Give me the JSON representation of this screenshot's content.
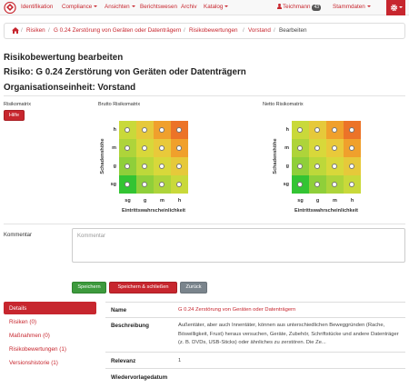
{
  "navbar": {
    "items": [
      {
        "label": "Identifikation"
      },
      {
        "label": "Compliance"
      },
      {
        "label": "Ansichten"
      },
      {
        "label": "Berichtswesen"
      },
      {
        "label": "Archiv"
      },
      {
        "label": "Katalog"
      }
    ],
    "user": "Teichmann",
    "user_badge": "43",
    "stammdaten": "Stammdaten",
    "accent": "#c7262e"
  },
  "breadcrumb": [
    "Risiken",
    "G 0.24 Zerstörung von Geräten oder Datenträgern",
    "Risikobewertungen",
    "Vorstand",
    "Bearbeiten"
  ],
  "headings": {
    "title": "Risikobewertung bearbeiten",
    "risk": "Risiko: G 0.24 Zerstörung von Geräten oder Datenträgern",
    "org": "Organisationseinheit: Vorstand"
  },
  "matrix_section": {
    "label": "Risikomatrix",
    "help_button": "Hilfe",
    "brutto_title": "Brutto Risikomatrix",
    "netto_title": "Netto Risikomatrix",
    "y_axis": "Schadenshöhe",
    "x_axis": "Eintrittswahrscheinlichkeit",
    "rows": [
      "h",
      "m",
      "g",
      "sg"
    ],
    "cols": [
      "sg",
      "g",
      "m",
      "h"
    ],
    "colors": [
      [
        "#c9d93a",
        "#e6c93a",
        "#f0a02c",
        "#ec7328"
      ],
      [
        "#aed43a",
        "#d8d83a",
        "#e9c93a",
        "#f0a02c"
      ],
      [
        "#8fcf3a",
        "#bdd83a",
        "#d8d83a",
        "#e6c93a"
      ],
      [
        "#33c433",
        "#8fcf3a",
        "#aed43a",
        "#c9d93a"
      ]
    ]
  },
  "comment": {
    "label": "Kommentar",
    "placeholder": "Kommentar"
  },
  "buttons": {
    "save": "Speichern",
    "save_close": "Speichern & schließen",
    "back": "Zurück"
  },
  "sidebar": [
    {
      "label": "Details"
    },
    {
      "label": "Risiken (0)"
    },
    {
      "label": "Maßnahmen (0)"
    },
    {
      "label": "Risikobewertungen (1)"
    },
    {
      "label": "Versionshistorie (1)"
    }
  ],
  "details": {
    "name_key": "Name",
    "name_val": "G 0.24 Zerstörung von Geräten oder Datenträgern",
    "desc_key": "Beschreibung",
    "desc_val": "Außentäter, aber auch Innentäter, können aus unterschiedlichen Beweggründen (Rache, Böswilligkeit, Frust) heraus versuchen, Geräte, Zubehör, Schriftstücke und andere Datenträger (z. B. DVDs, USB-Sticks) oder ähnliches zu zerstören. Die Ze...",
    "rel_key": "Relevanz",
    "rel_val": "1",
    "wv_key": "Wiedervorlagedatum",
    "wv_val": ""
  }
}
